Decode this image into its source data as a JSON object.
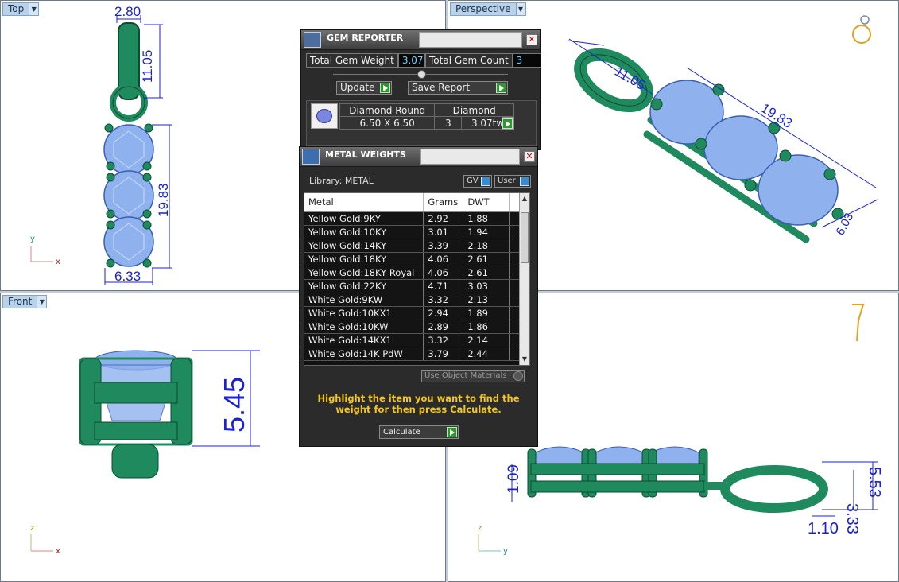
{
  "viewports": {
    "top": {
      "label": "Top",
      "dims": {
        "ring_width": "2.80",
        "bail_length": "11.05",
        "stones_length": "19.83",
        "stone_width": "6.33"
      },
      "axes": {
        "vertical": "y",
        "horizontal": "x"
      }
    },
    "perspective": {
      "label": "Perspective",
      "dims": {
        "bail_length": "11.05",
        "stones_length": "19.83",
        "extra": "6.03"
      }
    },
    "front": {
      "label": "Front",
      "dims": {
        "height": "5.45"
      },
      "axes": {
        "vertical": "z",
        "horizontal": "x"
      }
    },
    "right": {
      "dims": {
        "left": "1.09",
        "a": "3.33",
        "b": "5.53",
        "c": "1.10"
      },
      "axes": {
        "vertical": "z",
        "horizontal": "y"
      }
    }
  },
  "gem_reporter": {
    "title": "GEM REPORTER",
    "total_weight_label": "Total Gem Weight",
    "total_weight_value": "3.07",
    "total_count_label": "Total Gem Count",
    "total_count_value": "3",
    "update_button": "Update",
    "save_button": "Save Report",
    "gem": {
      "shape": "Diamond Round",
      "size": "6.50 X 6.50",
      "material": "Diamond",
      "count": "3",
      "weight": "3.07tw"
    }
  },
  "metal_weights": {
    "title": "METAL WEIGHTS",
    "library_label": "Library: METAL",
    "gv_button": "GV",
    "user_button": "User",
    "columns": [
      "Metal",
      "Grams",
      "DWT"
    ],
    "rows": [
      [
        "Yellow Gold:9KY",
        "2.92",
        "1.88"
      ],
      [
        "Yellow Gold:10KY",
        "3.01",
        "1.94"
      ],
      [
        "Yellow Gold:14KY",
        "3.39",
        "2.18"
      ],
      [
        "Yellow Gold:18KY",
        "4.06",
        "2.61"
      ],
      [
        "Yellow Gold:18KY Royal",
        "4.06",
        "2.61"
      ],
      [
        "Yellow Gold:22KY",
        "4.71",
        "3.03"
      ],
      [
        "White Gold:9KW",
        "3.32",
        "2.13"
      ],
      [
        "White Gold:10KX1",
        "2.94",
        "1.89"
      ],
      [
        "White Gold:10KW",
        "2.89",
        "1.86"
      ],
      [
        "White Gold:14KX1",
        "3.32",
        "2.14"
      ],
      [
        "White Gold:14K PdW",
        "3.79",
        "2.44"
      ]
    ],
    "use_object_materials": "Use Object Materials",
    "message": "Highlight the item you want to find the weight for then press Calculate.",
    "calculate_button": "Calculate"
  }
}
